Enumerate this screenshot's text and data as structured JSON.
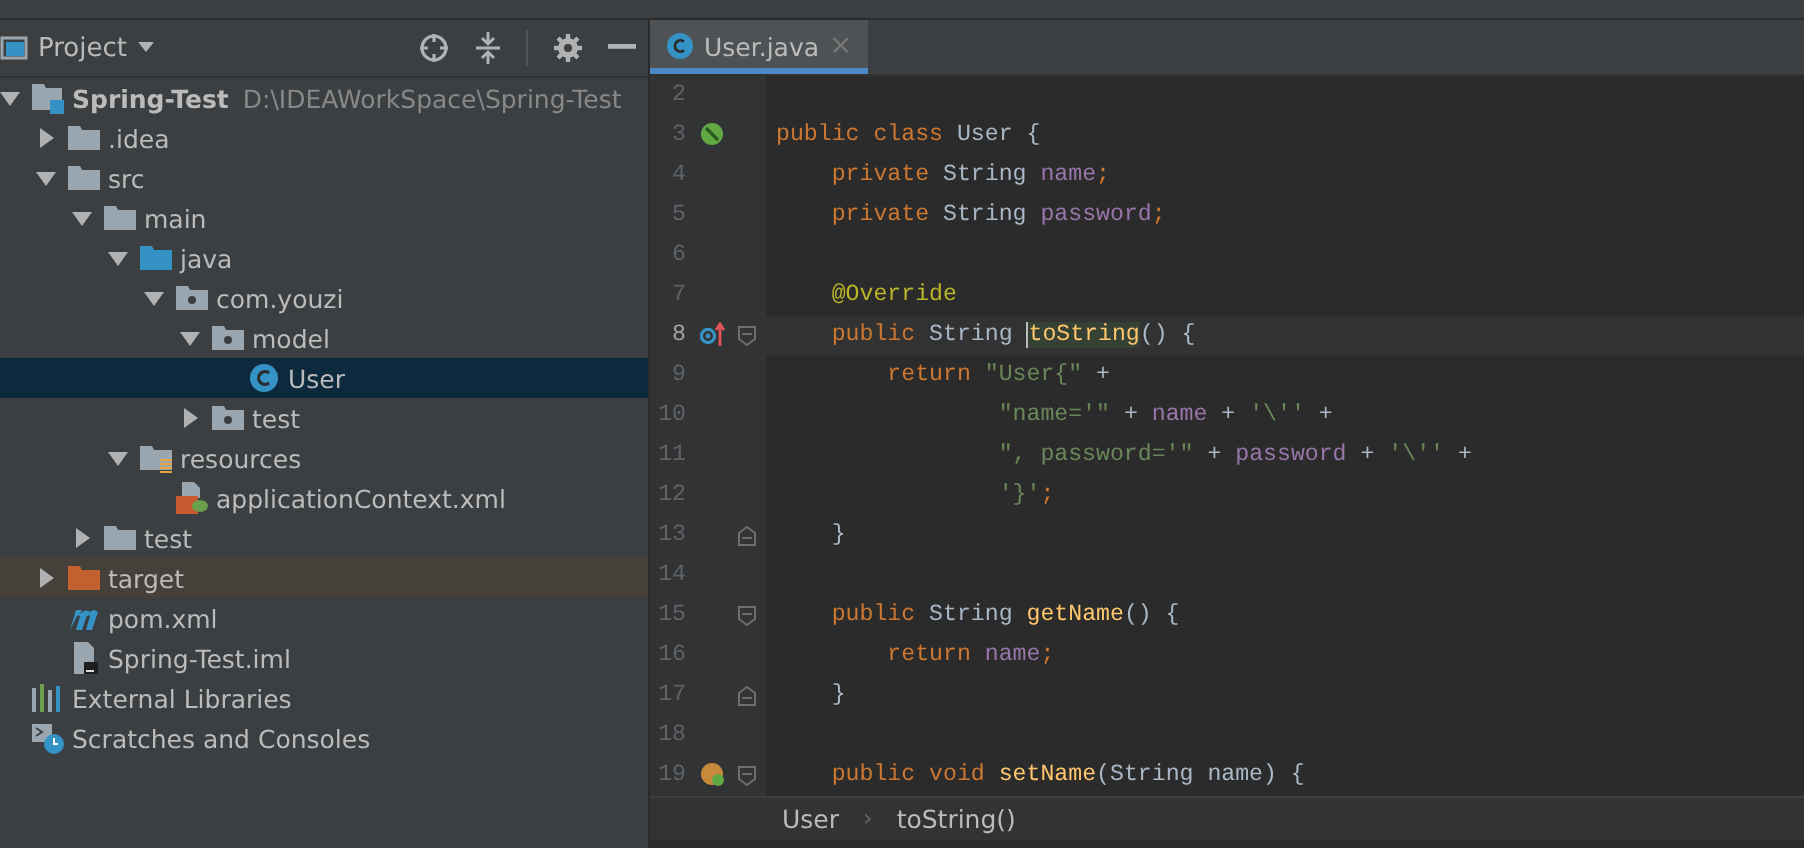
{
  "project_panel": {
    "title": "Project",
    "tree": [
      {
        "label": "Spring-Test",
        "path": "D:\\IDEAWorkSpace\\Spring-Test",
        "kind": "module",
        "expanded": true,
        "selected": false,
        "excluded": false,
        "children": [
          {
            "label": ".idea",
            "kind": "folder",
            "expanded": false,
            "selected": false,
            "excluded": false
          },
          {
            "label": "src",
            "kind": "folder",
            "expanded": true,
            "selected": false,
            "excluded": false,
            "children": [
              {
                "label": "main",
                "kind": "folder",
                "expanded": true,
                "selected": false,
                "excluded": false,
                "children": [
                  {
                    "label": "java",
                    "kind": "source",
                    "expanded": true,
                    "selected": false,
                    "excluded": false,
                    "children": [
                      {
                        "label": "com.youzi",
                        "kind": "package",
                        "expanded": true,
                        "selected": false,
                        "excluded": false,
                        "children": [
                          {
                            "label": "model",
                            "kind": "package",
                            "expanded": true,
                            "selected": false,
                            "excluded": false,
                            "children": [
                              {
                                "label": "User",
                                "kind": "class",
                                "selected": true,
                                "excluded": false
                              }
                            ]
                          },
                          {
                            "label": "test",
                            "kind": "package",
                            "expanded": false,
                            "selected": false,
                            "excluded": false
                          }
                        ]
                      }
                    ]
                  },
                  {
                    "label": "resources",
                    "kind": "resources",
                    "expanded": true,
                    "selected": false,
                    "excluded": false,
                    "children": [
                      {
                        "label": "applicationContext.xml",
                        "kind": "spring-xml",
                        "selected": false,
                        "excluded": false
                      }
                    ]
                  }
                ]
              },
              {
                "label": "test",
                "kind": "folder",
                "expanded": false,
                "selected": false,
                "excluded": false
              }
            ]
          },
          {
            "label": "target",
            "kind": "folder",
            "expanded": false,
            "selected": false,
            "excluded": true
          },
          {
            "label": "pom.xml",
            "kind": "maven",
            "selected": false,
            "excluded": false
          },
          {
            "label": "Spring-Test.iml",
            "kind": "iml",
            "selected": false,
            "excluded": false
          }
        ]
      },
      {
        "label": "External Libraries",
        "kind": "libraries",
        "selected": false,
        "excluded": false
      },
      {
        "label": "Scratches and Consoles",
        "kind": "scratches",
        "selected": false,
        "excluded": false
      }
    ]
  },
  "editor": {
    "tabs": [
      {
        "label": "User.java",
        "selected": true,
        "close": "×"
      }
    ],
    "lines": [
      {
        "number": "2",
        "current": false
      },
      {
        "number": "3",
        "current": false,
        "marker": {
          "kind": "bean"
        },
        "tokens": [
          {
            "text": "public class ",
            "kind": "keyword"
          },
          {
            "text": "User {",
            "kind": "plain"
          }
        ]
      },
      {
        "number": "4",
        "current": false,
        "tokens": [
          {
            "text": "    private ",
            "kind": "keyword"
          },
          {
            "text": "String ",
            "kind": "plain"
          },
          {
            "text": "name",
            "kind": "field"
          },
          {
            "text": ";",
            "kind": "keyword"
          }
        ]
      },
      {
        "number": "5",
        "current": false,
        "tokens": [
          {
            "text": "    private ",
            "kind": "keyword"
          },
          {
            "text": "String ",
            "kind": "plain"
          },
          {
            "text": "password",
            "kind": "field"
          },
          {
            "text": ";",
            "kind": "keyword"
          }
        ]
      },
      {
        "number": "6",
        "current": false
      },
      {
        "number": "7",
        "current": false,
        "tokens": [
          {
            "text": "    @Override",
            "kind": "annotation"
          }
        ]
      },
      {
        "number": "8",
        "current": true,
        "marker": {
          "kind": "override"
        },
        "fold": {
          "kind": "start"
        },
        "tokens": [
          {
            "text": "    public ",
            "kind": "keyword"
          },
          {
            "text": "String ",
            "kind": "plain"
          },
          {
            "text": "toString",
            "kind": "highlighted"
          },
          {
            "text": "() {",
            "kind": "plain"
          }
        ]
      },
      {
        "number": "9",
        "current": false,
        "tokens": [
          {
            "text": "        return ",
            "kind": "keyword"
          },
          {
            "text": "\"User{\"",
            "kind": "string"
          },
          {
            "text": " +",
            "kind": "plain"
          }
        ]
      },
      {
        "number": "10",
        "current": false,
        "tokens": [
          {
            "text": "                \"name='\"",
            "kind": "string"
          },
          {
            "text": " + ",
            "kind": "plain"
          },
          {
            "text": "name",
            "kind": "field"
          },
          {
            "text": " + ",
            "kind": "plain"
          },
          {
            "text": "'\\''",
            "kind": "string"
          },
          {
            "text": " +",
            "kind": "plain"
          }
        ]
      },
      {
        "number": "11",
        "current": false,
        "tokens": [
          {
            "text": "                \", password='\"",
            "kind": "string"
          },
          {
            "text": " + ",
            "kind": "plain"
          },
          {
            "text": "password",
            "kind": "field"
          },
          {
            "text": " + ",
            "kind": "plain"
          },
          {
            "text": "'\\''",
            "kind": "string"
          },
          {
            "text": " +",
            "kind": "plain"
          }
        ]
      },
      {
        "number": "12",
        "current": false,
        "tokens": [
          {
            "text": "                '}'",
            "kind": "string"
          },
          {
            "text": ";",
            "kind": "keyword"
          }
        ]
      },
      {
        "number": "13",
        "current": false,
        "fold": {
          "kind": "end"
        },
        "tokens": [
          {
            "text": "    }",
            "kind": "plain"
          }
        ]
      },
      {
        "number": "14",
        "current": false
      },
      {
        "number": "15",
        "current": false,
        "fold": {
          "kind": "start"
        },
        "tokens": [
          {
            "text": "    public ",
            "kind": "keyword"
          },
          {
            "text": "String ",
            "kind": "plain"
          },
          {
            "text": "getName",
            "kind": "method"
          },
          {
            "text": "() {",
            "kind": "plain"
          }
        ]
      },
      {
        "number": "16",
        "current": false,
        "tokens": [
          {
            "text": "        return ",
            "kind": "keyword"
          },
          {
            "text": "name",
            "kind": "field"
          },
          {
            "text": ";",
            "kind": "keyword"
          }
        ]
      },
      {
        "number": "17",
        "current": false,
        "fold": {
          "kind": "end"
        },
        "tokens": [
          {
            "text": "    }",
            "kind": "plain"
          }
        ]
      },
      {
        "number": "18",
        "current": false
      },
      {
        "number": "19",
        "current": false,
        "marker": {
          "kind": "property"
        },
        "fold": {
          "kind": "start"
        },
        "tokens": [
          {
            "text": "    public void ",
            "kind": "keyword"
          },
          {
            "text": "setName",
            "kind": "method"
          },
          {
            "text": "(String name) {",
            "kind": "plain"
          }
        ]
      }
    ],
    "breadcrumbs": [
      "User",
      "toString()"
    ],
    "breadcrumb_separator": "›"
  }
}
